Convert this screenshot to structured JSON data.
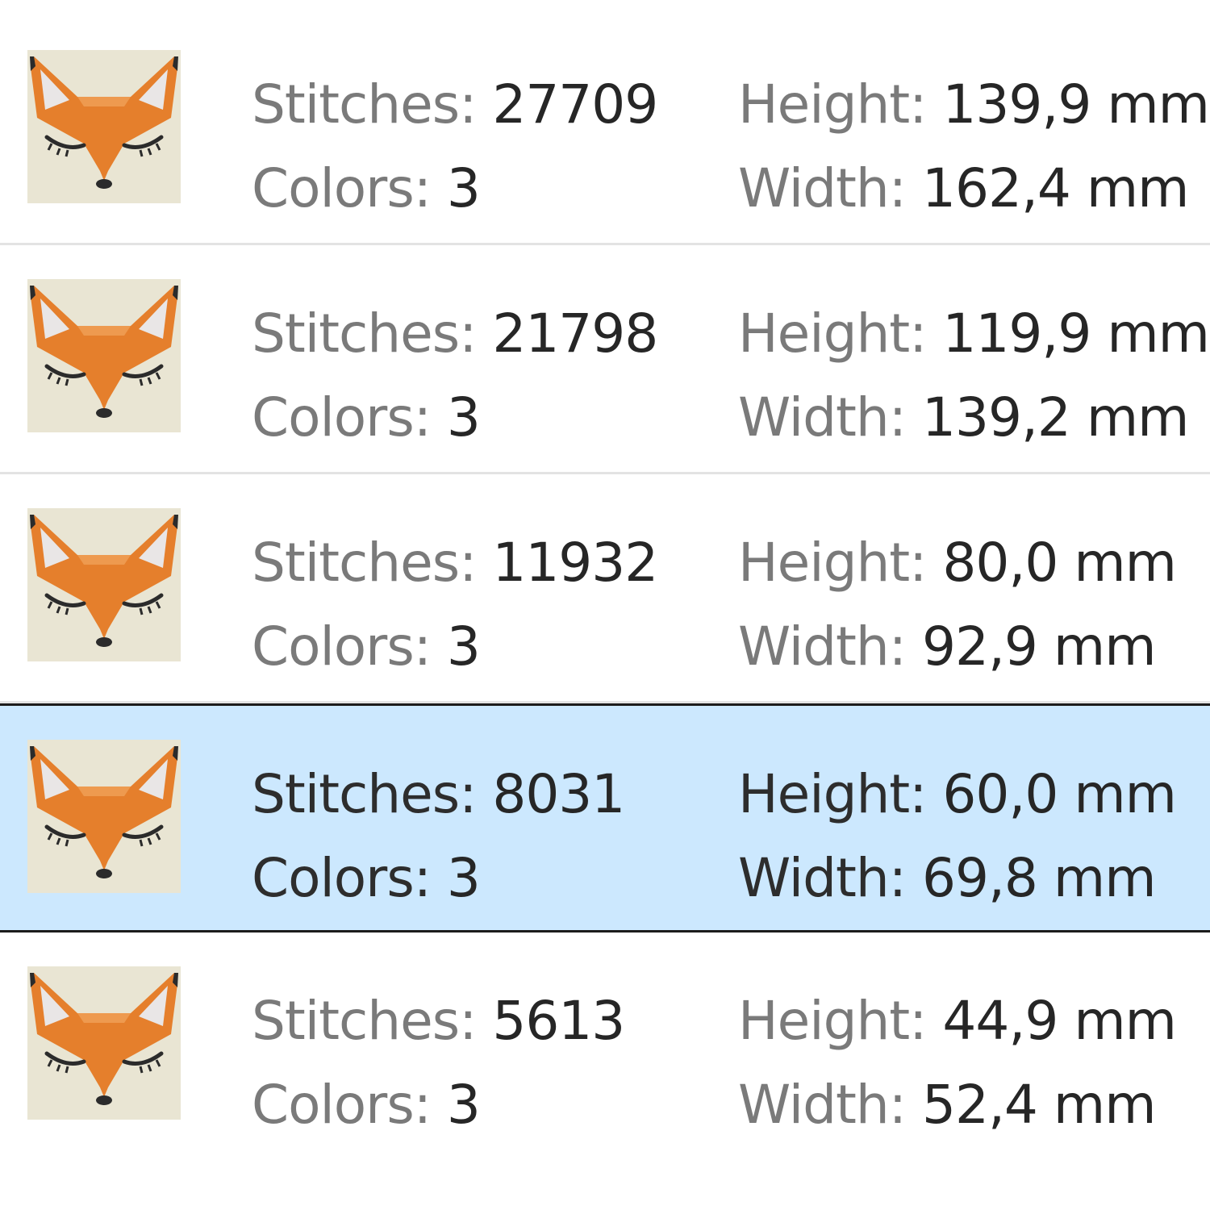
{
  "labels": {
    "stitches": "Stitches:",
    "colors": "Colors:",
    "height": "Height:",
    "width": "Width:"
  },
  "colors": {
    "selected_background": "#cce8fe",
    "thumbnail_background": "#e9e5d3",
    "fox_orange": "#e57f2c"
  },
  "designs": [
    {
      "thumbnail_icon": "fox-face-icon",
      "stitches": "27709",
      "colors": "3",
      "height": "139,9 mm",
      "width": "162,4 mm",
      "selected": false
    },
    {
      "thumbnail_icon": "fox-face-icon",
      "stitches": "21798",
      "colors": "3",
      "height": "119,9 mm",
      "width": "139,2 mm",
      "selected": false
    },
    {
      "thumbnail_icon": "fox-face-icon",
      "stitches": "11932",
      "colors": "3",
      "height": "80,0 mm",
      "width": "92,9 mm",
      "selected": false
    },
    {
      "thumbnail_icon": "fox-face-icon",
      "stitches": "8031",
      "colors": "3",
      "height": "60,0 mm",
      "width": "69,8 mm",
      "selected": true
    },
    {
      "thumbnail_icon": "fox-face-icon",
      "stitches": "5613",
      "colors": "3",
      "height": "44,9 mm",
      "width": "52,4 mm",
      "selected": false
    }
  ]
}
